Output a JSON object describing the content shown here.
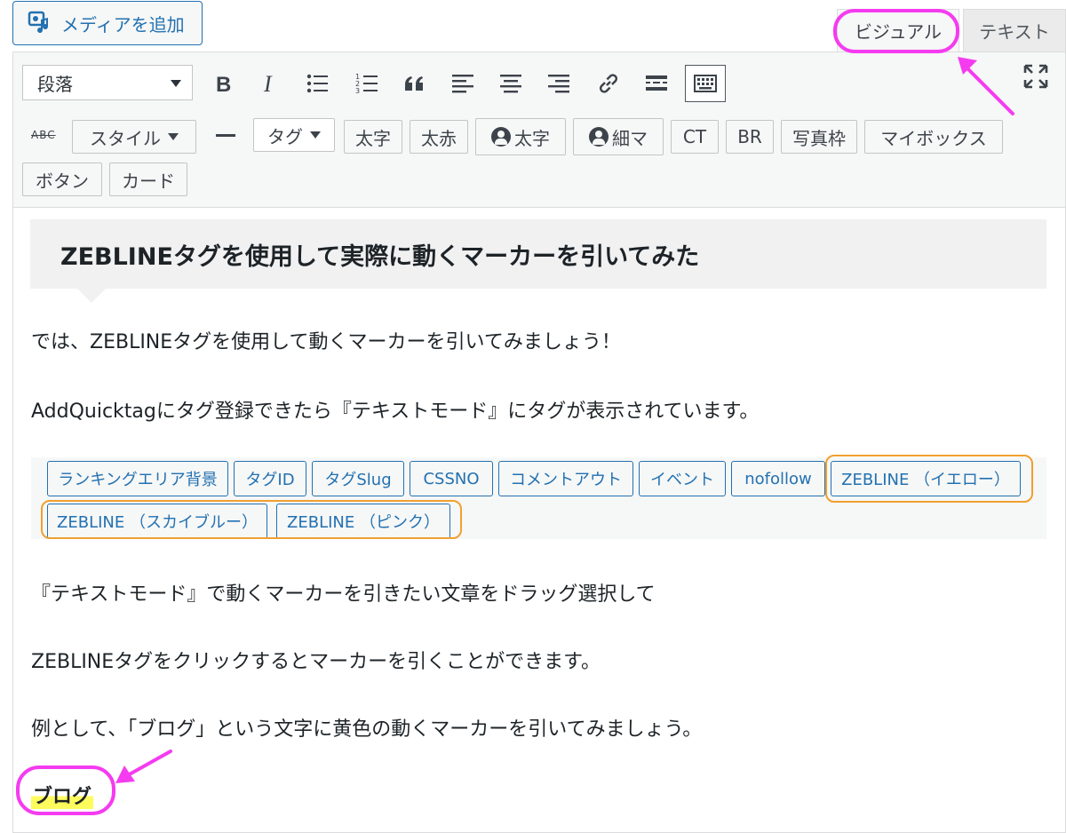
{
  "top": {
    "media_button": "メディアを追加",
    "tabs": {
      "visual": "ビジュアル",
      "text": "テキスト"
    }
  },
  "toolbar": {
    "format_select": "段落",
    "row2": {
      "style": "スタイル",
      "tag": "タグ",
      "bold_jp": "太字",
      "bold_red": "太赤",
      "user_bold": "太字",
      "user_thin": "細マ",
      "ct": "CT",
      "br": "BR",
      "photo_frame": "写真枠",
      "mybox": "マイボックス"
    },
    "row3": {
      "button": "ボタン",
      "card": "カード"
    }
  },
  "content": {
    "heading": "ZEBLINEタグを使用して実際に動くマーカーを引いてみた",
    "p1": "では、ZEBLINEタグを使用して動くマーカーを引いてみましょう！",
    "p2": "AddQuicktagにタグ登録できたら『テキストモード』にタグが表示されています。",
    "quicktags": [
      "ランキングエリア背景",
      "タグID",
      "タグSlug",
      "CSSNO",
      "コメントアウト",
      "イベント",
      "nofollow",
      "ZEBLINE （イエロー）",
      "ZEBLINE （スカイブルー）",
      "ZEBLINE （ピンク）"
    ],
    "p3": "『テキストモード』で動くマーカーを引きたい文章をドラッグ選択して",
    "p4": "ZEBLINEタグをクリックするとマーカーを引くことができます。",
    "p5": "例として、「ブログ」という文字に黄色の動くマーカーを引いてみましょう。",
    "marked_word": "ブログ"
  },
  "colors": {
    "accent": "#2271b1",
    "annotation_circle": "#f53bf0",
    "highlight_orange": "#f0a030",
    "marker_yellow": "#fdfc5d"
  }
}
